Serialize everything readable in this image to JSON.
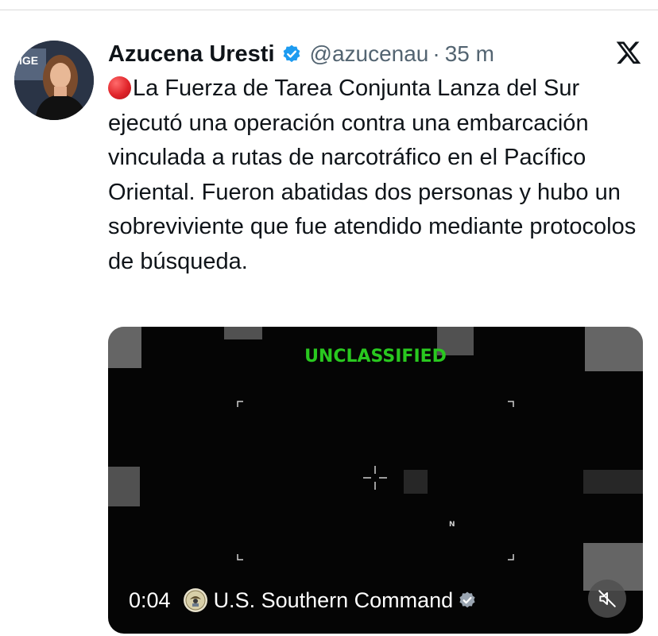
{
  "author": {
    "display_name": "Azucena Uresti",
    "handle": "@azucenau",
    "separator": "·",
    "time": "35 m",
    "verified_icon": "verified-badge-icon",
    "avatar_text": "IGE"
  },
  "platform": {
    "logo_icon": "x-logo-icon"
  },
  "tweet": {
    "emoji_icon": "red-circle-icon",
    "text": "La Fuerza de Tarea Conjunta Lanza del Sur ejecutó una operación contra una embarcación vinculada a rutas de narcotráfico en el Pacífico Oriental. Fueron abatidas dos personas y hubo un sobreviviente que fue atendido mediante protocolos de búsqueda."
  },
  "media": {
    "overlay_label": "UNCLASSIFIED",
    "compass_label": "N",
    "duration": "0:04",
    "source_name": "U.S. Southern Command",
    "source_icon": "southcom-seal-icon",
    "mute_icon": "muted-speaker-icon",
    "colors": {
      "overlay_green": "#29c81f",
      "verified_blue": "#1d9bf0"
    }
  }
}
